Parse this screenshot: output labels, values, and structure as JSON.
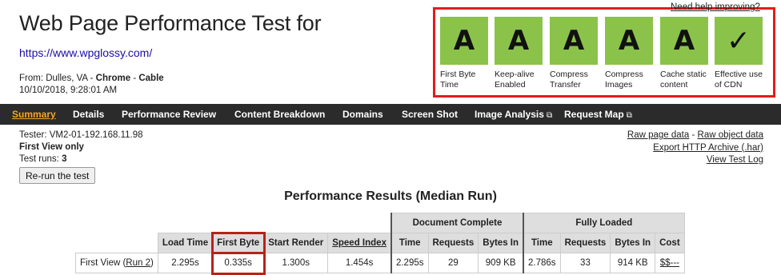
{
  "header": {
    "title": "Web Page Performance Test for",
    "url": "https://www.wpglossy.com/",
    "from_label": "From:",
    "from_location": "Dulles, VA",
    "from_browser": "Chrome",
    "from_connection": "Cable",
    "date": "10/10/2018, 9:28:01 AM",
    "help_link": "Need help improving?"
  },
  "grades": [
    {
      "grade": "A",
      "label": "First Byte Time",
      "color": "#8bc34a"
    },
    {
      "grade": "A",
      "label": "Keep-alive Enabled",
      "color": "#8bc34a"
    },
    {
      "grade": "A",
      "label": "Compress Transfer",
      "color": "#8bc34a"
    },
    {
      "grade": "A",
      "label": "Compress Images",
      "color": "#8bc34a"
    },
    {
      "grade": "A",
      "label": "Cache static content",
      "color": "#8bc34a"
    },
    {
      "grade": "✓",
      "label": "Effective use of CDN",
      "color": "#8bc34a"
    }
  ],
  "nav": {
    "items": [
      "Summary",
      "Details",
      "Performance Review",
      "Content Breakdown",
      "Domains",
      "Screen Shot",
      "Image Analysis",
      "Request Map"
    ],
    "active": "Summary"
  },
  "tester": {
    "tester": "Tester: VM2-01-192.168.11.98",
    "view": "First View only",
    "runs_label": "Test runs:",
    "runs": "3",
    "rerun_button": "Re-run the test"
  },
  "links": {
    "raw_page": "Raw page data",
    "sep": "-",
    "raw_object": "Raw object data",
    "export_har": "Export HTTP Archive (.har)",
    "view_log": "View Test Log"
  },
  "results": {
    "title": "Performance Results (Median Run)",
    "group_document": "Document Complete",
    "group_fully": "Fully Loaded",
    "headers": [
      "Load Time",
      "First Byte",
      "Start Render",
      "Speed Index",
      "Time",
      "Requests",
      "Bytes In",
      "Time",
      "Requests",
      "Bytes In",
      "Cost"
    ],
    "row_label": "First View (",
    "row_link": "Run 2",
    "row_label_end": ")",
    "values": [
      "2.295s",
      "0.335s",
      "1.300s",
      "1.454s",
      "2.295s",
      "29",
      "909 KB",
      "2.786s",
      "33",
      "914 KB",
      "$$---"
    ]
  }
}
